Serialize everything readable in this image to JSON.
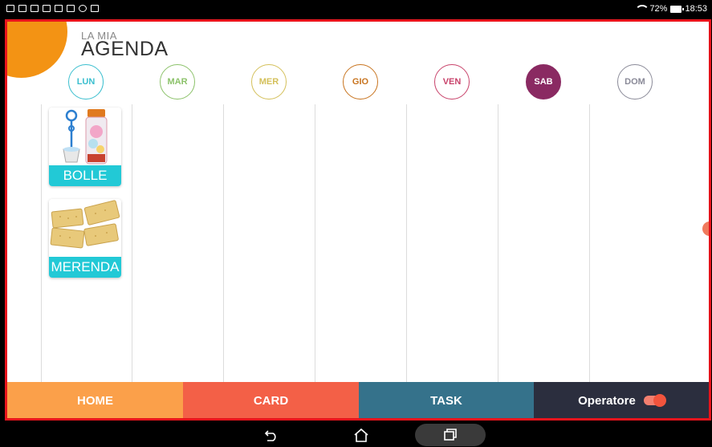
{
  "statusbar": {
    "battery_text": "72%",
    "time": "18:53",
    "left_icons": [
      "photo-icon",
      "video-icon",
      "facebook-icon",
      "facebook-icon",
      "gallery-icon",
      "mail-icon",
      "globe-icon",
      "mail-icon"
    ]
  },
  "header": {
    "subtitle": "LA MIA",
    "title": "AGENDA"
  },
  "days": [
    {
      "label": "LUN",
      "color": "#3bbfcf",
      "active": false
    },
    {
      "label": "MAR",
      "color": "#8cc26a",
      "active": false
    },
    {
      "label": "MER",
      "color": "#d4c05a",
      "active": false
    },
    {
      "label": "GIO",
      "color": "#c8741f",
      "active": false
    },
    {
      "label": "VEN",
      "color": "#c8426a",
      "active": false
    },
    {
      "label": "SAB",
      "color": "#8a2a62",
      "active": true
    },
    {
      "label": "DOM",
      "color": "#8a8a98",
      "active": false
    }
  ],
  "cards": [
    {
      "label": "BOLLE",
      "image": "bubbles-toy-icon"
    },
    {
      "label": "MERENDA",
      "image": "crackers-icon"
    }
  ],
  "tabs": [
    {
      "label": "HOME",
      "color": "#fba04a"
    },
    {
      "label": "CARD",
      "color": "#f36047"
    },
    {
      "label": "TASK",
      "color": "#35728b"
    },
    {
      "label": "Operatore",
      "color": "#2b2e3e",
      "toggle": true
    }
  ],
  "colors": {
    "accent_orange": "#f39314",
    "card_label_bg": "#22c9d6",
    "frame_red": "#e8141c"
  },
  "navbar": [
    "back-icon",
    "home-icon",
    "recents-icon"
  ]
}
